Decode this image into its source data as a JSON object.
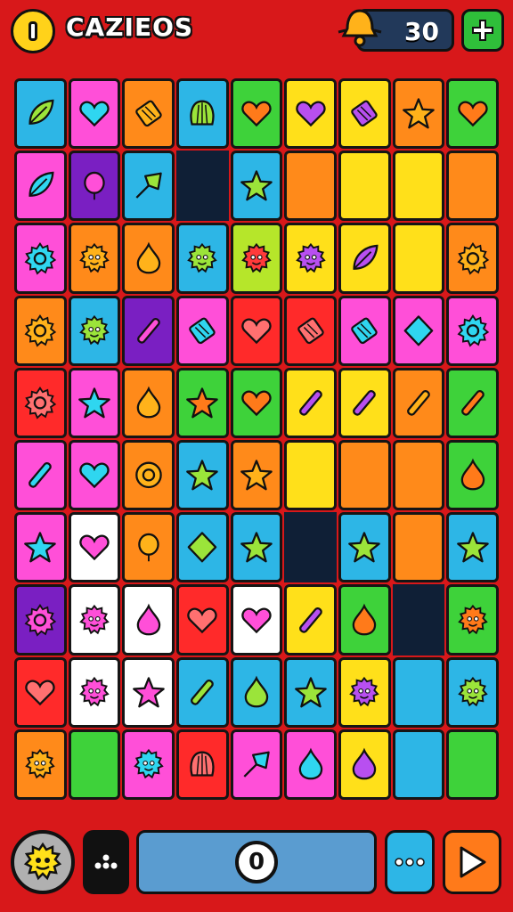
{
  "header": {
    "title": "CAZIEOS",
    "score": "30",
    "back_icon": "back-icon",
    "bell_icon": "bell-icon",
    "add_icon": "plus-icon"
  },
  "palette": {
    "background": "#d8181a",
    "gap": "#0f1f36",
    "cyan": "#2db6e6",
    "pink": "#ff4fd8",
    "orange": "#ff8a1a",
    "green": "#3ed23a",
    "lime": "#b6e62a",
    "yellow": "#ffe01a",
    "purple": "#7a1fc2",
    "red": "#ff2a2a",
    "white": "#ffffff"
  },
  "board": {
    "tiles": [
      {
        "color": "cyan",
        "icon": "leaf"
      },
      {
        "color": "pink",
        "icon": "heart"
      },
      {
        "color": "orange",
        "icon": "candy"
      },
      {
        "color": "cyan",
        "icon": "shell"
      },
      {
        "color": "green",
        "icon": "heart"
      },
      {
        "color": "yellow",
        "icon": "heart"
      },
      {
        "color": "yellow",
        "icon": "candy"
      },
      {
        "color": "orange",
        "icon": "star"
      },
      {
        "color": "green",
        "icon": "heart"
      },
      {
        "color": "pink",
        "icon": "leaf"
      },
      {
        "color": "purple",
        "icon": "balloon"
      },
      {
        "color": "cyan",
        "icon": "arrow"
      },
      {
        "color": "gap",
        "icon": ""
      },
      {
        "color": "cyan",
        "icon": "star"
      },
      {
        "color": "orange",
        "icon": ""
      },
      {
        "color": "yellow",
        "icon": ""
      },
      {
        "color": "yellow",
        "icon": ""
      },
      {
        "color": "orange",
        "icon": ""
      },
      {
        "color": "pink",
        "icon": "gear"
      },
      {
        "color": "orange",
        "icon": "monster"
      },
      {
        "color": "orange",
        "icon": "drop"
      },
      {
        "color": "cyan",
        "icon": "monster"
      },
      {
        "color": "lime",
        "icon": "monster"
      },
      {
        "color": "yellow",
        "icon": "monster"
      },
      {
        "color": "yellow",
        "icon": "leaf"
      },
      {
        "color": "yellow",
        "icon": ""
      },
      {
        "color": "orange",
        "icon": "gear"
      },
      {
        "color": "orange",
        "icon": "gear"
      },
      {
        "color": "cyan",
        "icon": "monster"
      },
      {
        "color": "purple",
        "icon": "wand"
      },
      {
        "color": "pink",
        "icon": "candy"
      },
      {
        "color": "red",
        "icon": "heart"
      },
      {
        "color": "red",
        "icon": "candy"
      },
      {
        "color": "pink",
        "icon": "candy"
      },
      {
        "color": "pink",
        "icon": "diamond"
      },
      {
        "color": "pink",
        "icon": "gear"
      },
      {
        "color": "red",
        "icon": "gear"
      },
      {
        "color": "pink",
        "icon": "star"
      },
      {
        "color": "orange",
        "icon": "drop"
      },
      {
        "color": "green",
        "icon": "star"
      },
      {
        "color": "green",
        "icon": "heart"
      },
      {
        "color": "yellow",
        "icon": "wand"
      },
      {
        "color": "yellow",
        "icon": "wand"
      },
      {
        "color": "orange",
        "icon": "wand"
      },
      {
        "color": "green",
        "icon": "wand"
      },
      {
        "color": "pink",
        "icon": "wand"
      },
      {
        "color": "pink",
        "icon": "heart"
      },
      {
        "color": "orange",
        "icon": "ring"
      },
      {
        "color": "cyan",
        "icon": "star"
      },
      {
        "color": "orange",
        "icon": "star"
      },
      {
        "color": "yellow",
        "icon": ""
      },
      {
        "color": "orange",
        "icon": ""
      },
      {
        "color": "orange",
        "icon": ""
      },
      {
        "color": "green",
        "icon": "drop"
      },
      {
        "color": "pink",
        "icon": "star"
      },
      {
        "color": "white",
        "icon": "heart"
      },
      {
        "color": "orange",
        "icon": "balloon"
      },
      {
        "color": "cyan",
        "icon": "diamond"
      },
      {
        "color": "cyan",
        "icon": "star"
      },
      {
        "color": "gap",
        "icon": ""
      },
      {
        "color": "cyan",
        "icon": "star"
      },
      {
        "color": "orange",
        "icon": ""
      },
      {
        "color": "cyan",
        "icon": "star"
      },
      {
        "color": "purple",
        "icon": "gear"
      },
      {
        "color": "white",
        "icon": "monster"
      },
      {
        "color": "white",
        "icon": "drop"
      },
      {
        "color": "red",
        "icon": "heart"
      },
      {
        "color": "white",
        "icon": "heart"
      },
      {
        "color": "yellow",
        "icon": "wand"
      },
      {
        "color": "green",
        "icon": "drop"
      },
      {
        "color": "gap",
        "icon": ""
      },
      {
        "color": "green",
        "icon": "monster"
      },
      {
        "color": "red",
        "icon": "heart"
      },
      {
        "color": "white",
        "icon": "monster"
      },
      {
        "color": "white",
        "icon": "star"
      },
      {
        "color": "cyan",
        "icon": "wand"
      },
      {
        "color": "cyan",
        "icon": "drop"
      },
      {
        "color": "cyan",
        "icon": "star"
      },
      {
        "color": "yellow",
        "icon": "monster"
      },
      {
        "color": "cyan",
        "icon": ""
      },
      {
        "color": "cyan",
        "icon": "monster"
      },
      {
        "color": "orange",
        "icon": "monster"
      },
      {
        "color": "green",
        "icon": ""
      },
      {
        "color": "pink",
        "icon": "monster"
      },
      {
        "color": "red",
        "icon": "shell"
      },
      {
        "color": "pink",
        "icon": "arrow"
      },
      {
        "color": "pink",
        "icon": "drop"
      },
      {
        "color": "yellow",
        "icon": "drop"
      },
      {
        "color": "cyan",
        "icon": ""
      },
      {
        "color": "green",
        "icon": ""
      }
    ]
  },
  "footer": {
    "avatar_icon": "monster-avatar-icon",
    "dots_icon": "dots-menu-icon",
    "progress_value": "0",
    "more_icon": "ellipsis-icon",
    "play_icon": "play-icon"
  }
}
